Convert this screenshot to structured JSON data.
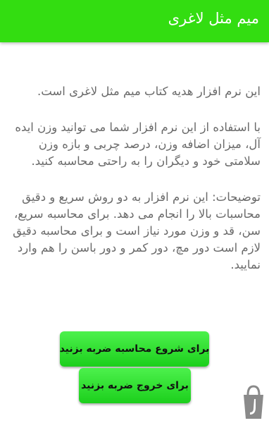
{
  "appbar": {
    "title": "میم مثل لاغری"
  },
  "content": {
    "paragraphs": [
      "این نرم افزار هدیه کتاب میم مثل لاغری است.",
      "با استفاده از این نرم افزار شما می توانید وزن ایده آل، میزان اضافه وزن، درصد چربی و بازه وزن سلامتی خود و دیگران را به راحتی محاسبه کنید.",
      "توضیحات: این نرم افزار به دو روش سریع و دقیق محاسبات بالا را انجام می دهد. برای محاسبه سریع، سن، قد و وزن مورد نیاز است و برای محاسبه دقیق لازم است دور مچ، دور کمر و دور باسن را هم وارد نمایید."
    ]
  },
  "buttons": {
    "start_label": "برای شروع محاسبه ضربه بزنید",
    "exit_label": "برای خروج ضربه بزنید"
  },
  "brand": {
    "icon": "bazaar-logo-icon",
    "color": "#8a8a8a"
  },
  "colors": {
    "accent": "#33dd11",
    "button": "#2fe02f",
    "text": "#6a6a6a"
  }
}
